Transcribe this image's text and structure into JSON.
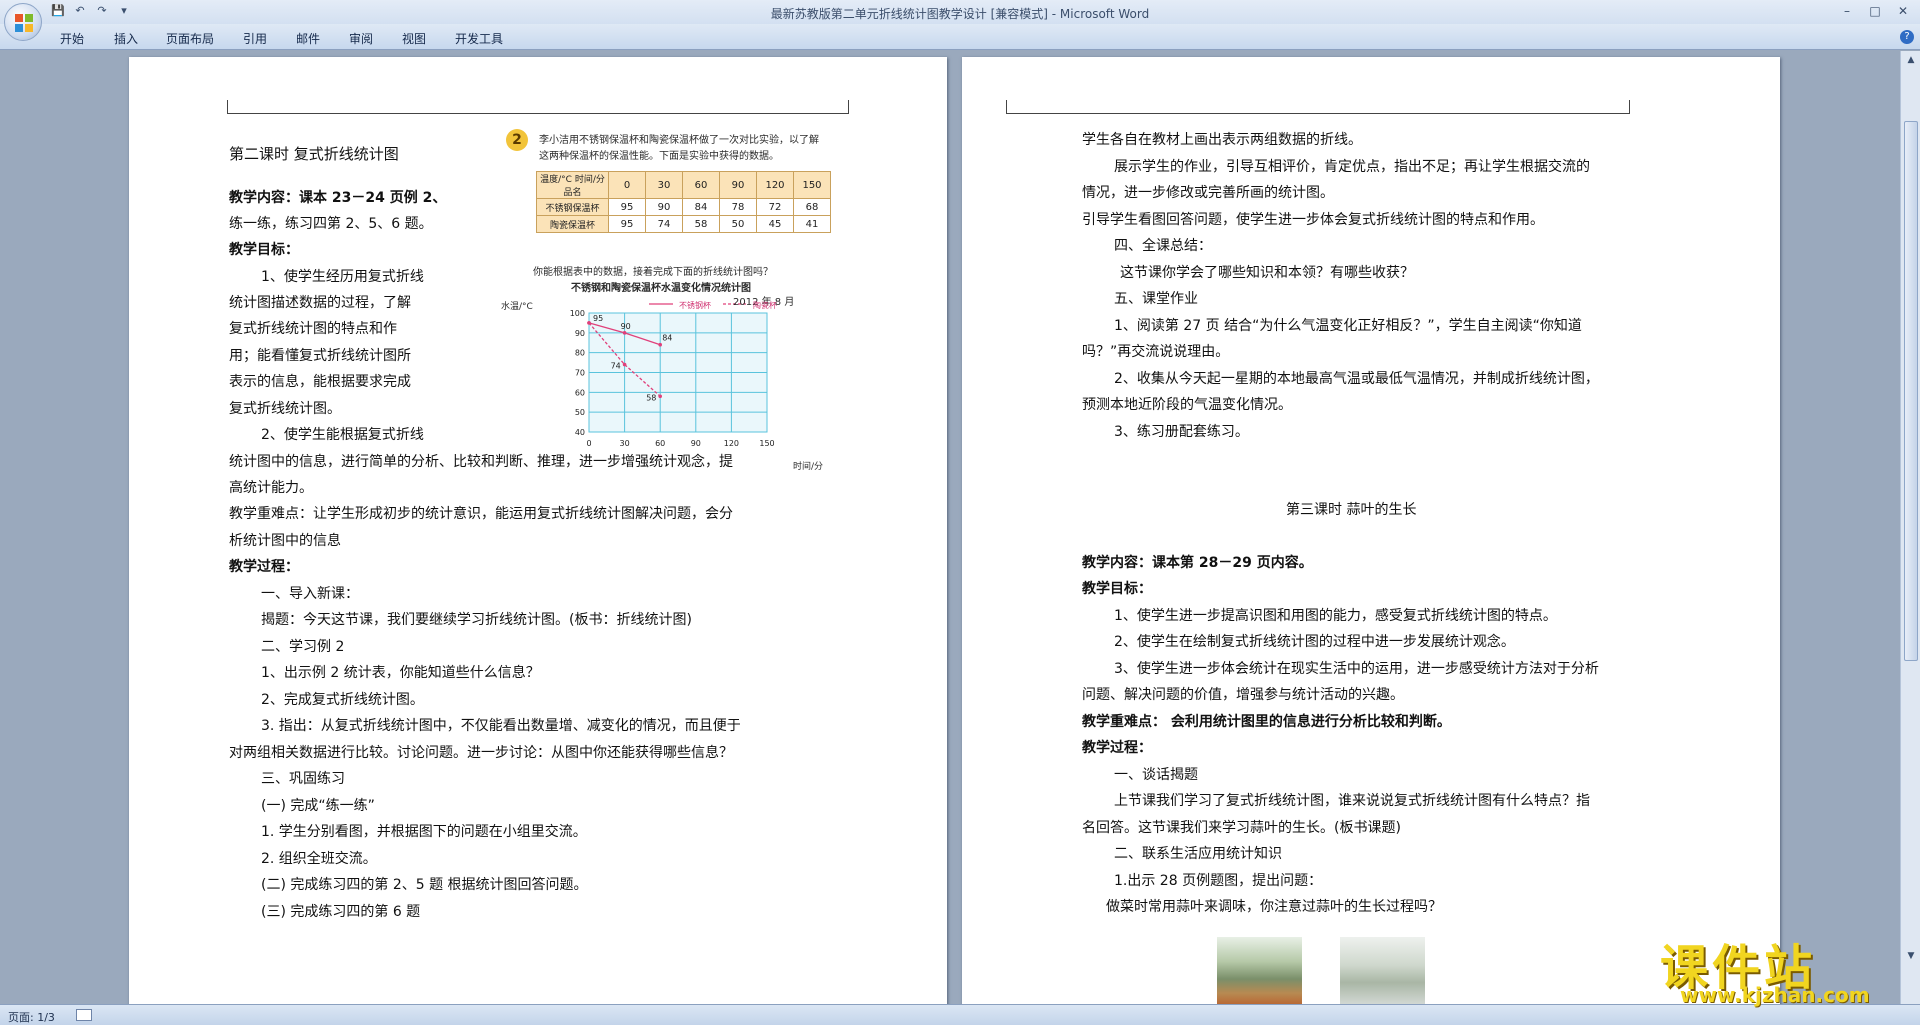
{
  "window": {
    "title": "最新苏教版第二单元折线统计图教学设计 [兼容模式] - Microsoft Word",
    "controls": [
      "–",
      "□",
      "✕"
    ]
  },
  "quick_access": [
    "save-icon",
    "undo-icon",
    "redo-icon",
    "customize-icon"
  ],
  "ribbon_tabs": [
    "开始",
    "插入",
    "页面布局",
    "引用",
    "邮件",
    "审阅",
    "视图",
    "开发工具"
  ],
  "help_label": "?",
  "status": {
    "page": "页面: 1/3"
  },
  "page1": {
    "image_problem_num": "2",
    "image_problem_text1": "李小洁用不锈钢保温杯和陶瓷保温杯做了一次对比实验，以了解",
    "image_problem_text2": "这两种保温杯的保温性能。下面是实验中获得的数据。",
    "table_header_label": "温度/°C  时间/分  品名",
    "table_times": [
      "0",
      "30",
      "60",
      "90",
      "120",
      "150"
    ],
    "table_rows": [
      {
        "name": "不锈钢保温杯",
        "values": [
          "95",
          "90",
          "84",
          "78",
          "72",
          "68"
        ]
      },
      {
        "name": "陶瓷保温杯",
        "values": [
          "95",
          "74",
          "58",
          "50",
          "45",
          "41"
        ]
      }
    ],
    "image_question": "你能根据表中的数据，接着完成下面的折线统计图吗？",
    "lines": [
      "第二课时   复式折线统计图",
      "教学内容：课本 23－24 页例 2、",
      "练一练，练习四第 2、5、6 题。",
      "教学目标：",
      "1、使学生经历用复式折线",
      "统计图描述数据的过程，了解",
      "复式折线统计图的特点和作",
      "用；能看懂复式折线统计图所",
      "表示的信息，能根据要求完成",
      "复式折线统计图。",
      "2、使学生能根据复式折线",
      "统计图中的信息，进行简单的分析、比较和判断、推理，进一步增强统计观念，提",
      "高统计能力。",
      "教学重难点：让学生形成初步的统计意识，能运用复式折线统计图解决问题，会分",
      "析统计图中的信息",
      "教学过程：",
      "一、导入新课：",
      "揭题：今天这节课，我们要继续学习折线统计图。(板书：折线统计图)",
      "二、学习例 2",
      "1、出示例 2 统计表，你能知道些什么信息？",
      "2、完成复式折线统计图。",
      "3. 指出：从复式折线统计图中，不仅能看出数量增、减变化的情况，而且便于",
      "对两组相关数据进行比较。讨论问题。进一步讨论：从图中你还能获得哪些信息？",
      "三、巩固练习",
      "(一) 完成“练一练”",
      "1. 学生分别看图，并根据图下的问题在小组里交流。",
      "2. 组织全班交流。",
      "(二) 完成练习四的第 2、5 题   根据统计图回答问题。",
      "(三) 完成练习四的第 6 题"
    ]
  },
  "chart_data": {
    "type": "line",
    "title": "不锈钢和陶瓷保温杯水温变化情况统计图",
    "subtitle": "2012 年 8 月",
    "xlabel": "时间/分",
    "ylabel": "水温/°C",
    "x": [
      0,
      30,
      60,
      90,
      120,
      150
    ],
    "xlim": [
      0,
      150
    ],
    "ylim": [
      40,
      100
    ],
    "yticks": [
      40,
      50,
      60,
      70,
      80,
      90,
      100
    ],
    "grid": true,
    "legend_position": "top-right",
    "series": [
      {
        "name": "不锈钢杯",
        "x": [
          0,
          30,
          60
        ],
        "values": [
          95,
          90,
          84
        ],
        "color": "#e0407a",
        "dash": false
      },
      {
        "name": "陶瓷杯",
        "x": [
          0,
          30,
          60
        ],
        "values": [
          95,
          74,
          58
        ],
        "color": "#e0407a",
        "dash": true
      }
    ],
    "data_labels": [
      "95",
      "90",
      "84",
      "74",
      "58"
    ]
  },
  "page2": {
    "lines": [
      "学生各自在教材上画出表示两组数据的折线。",
      "展示学生的作业，引导互相评价，肯定优点，指出不足；再让学生根据交流的",
      "情况，进一步修改或完善所画的统计图。",
      "引导学生看图回答问题，使学生进一步体会复式折线统计图的特点和作用。",
      "四、全课总结：",
      "这节课你学会了哪些知识和本领？有哪些收获？",
      "五、课堂作业",
      "1、阅读第 27 页   结合“为什么气温变化正好相反？”，学生自主阅读“你知道",
      "吗？”再交流说说理由。",
      "2、收集从今天起一星期的本地最高气温或最低气温情况，并制成折线统计图，",
      "预测本地近阶段的气温变化情况。",
      "3、练习册配套练习。",
      "第三课时     蒜叶的生长",
      "教学内容：课本第 28－29 页内容。",
      "教学目标：",
      "1、使学生进一步提高识图和用图的能力，感受复式折线统计图的特点。",
      "2、使学生在绘制复式折线统计图的过程中进一步发展统计观念。",
      "3、使学生进一步体会统计在现实生活中的运用，进一步感受统计方法对于分析",
      "问题、解决问题的价值，增强参与统计活动的兴趣。",
      "教学重难点：   会利用统计图里的信息进行分析比较和判断。",
      "教学过程：",
      "一、谈话揭题",
      "上节课我们学习了复式折线统计图，谁来说说复式折线统计图有什么特点？指",
      "名回答。这节课我们来学习蒜叶的生长。(板书课题)",
      "二、联系生活应用统计知识",
      "1.出示 28 页例题图，提出问题：",
      "做菜时常用蒜叶来调味，你注意过蒜叶的生长过程吗？"
    ]
  },
  "watermark": {
    "brand": "课件站",
    "url": "www.kjzhan.com"
  }
}
